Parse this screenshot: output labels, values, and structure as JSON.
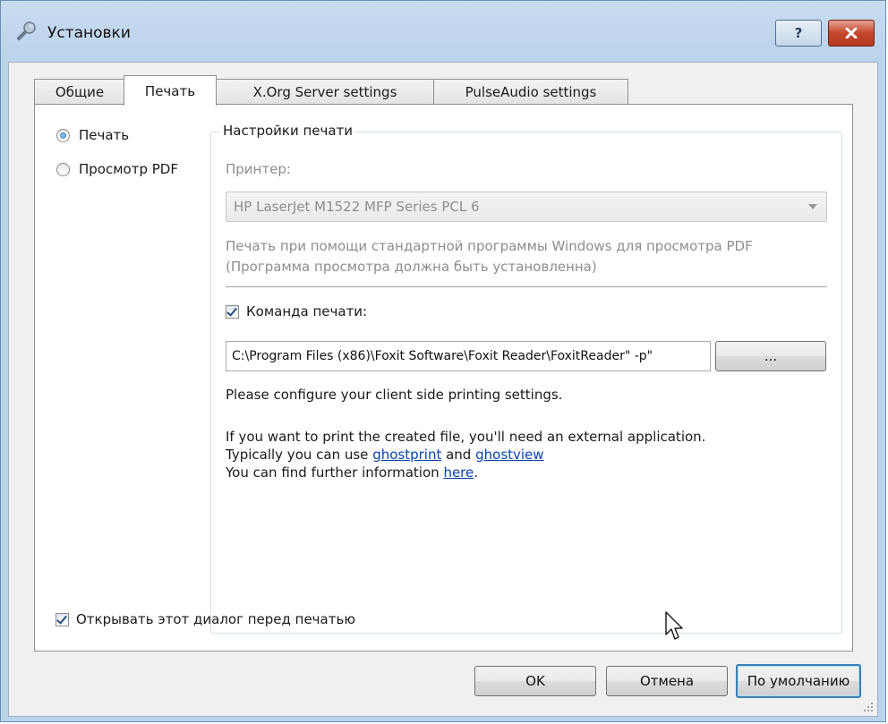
{
  "window": {
    "title": "Установки",
    "help_label": "?",
    "close_label": "x"
  },
  "tabs": [
    {
      "label": "Общие"
    },
    {
      "label": "Печать"
    },
    {
      "label": "X.Org Server settings"
    },
    {
      "label": "PulseAudio settings"
    }
  ],
  "mode": {
    "print_label": "Печать",
    "pdf_label": "Просмотр PDF"
  },
  "print_settings": {
    "legend": "Настройки печати",
    "printer_label": "Принтер:",
    "printer_value": "HP LaserJet M1522 MFP Series PCL 6",
    "info_line1": "Печать при помощи стандартной программы Windows для просмотра PDF",
    "info_line2": "(Программа просмотра должна быть установленна)",
    "command_label": "Команда печати:",
    "command_value": "\"C:\\Program Files (x86)\\Foxit Software\\Foxit Reader\\FoxitReader\" -p",
    "browse_label": "...",
    "client_note": "Please configure your client side printing settings.",
    "ext_line1": "If you want to print the created file, you'll need an external application.",
    "ext_line2_prefix": "Typically you can use ",
    "ext_link1": "ghostprint",
    "ext_and": " and ",
    "ext_link2": "ghostview",
    "ext_line3_prefix": "You can find further information ",
    "ext_link3": "here",
    "ext_line3_suffix": "."
  },
  "open_dialog_label": "Открывать этот диалог перед печатью",
  "buttons": {
    "ok": "OK",
    "cancel": "Отмена",
    "default": "По умолчанию"
  }
}
